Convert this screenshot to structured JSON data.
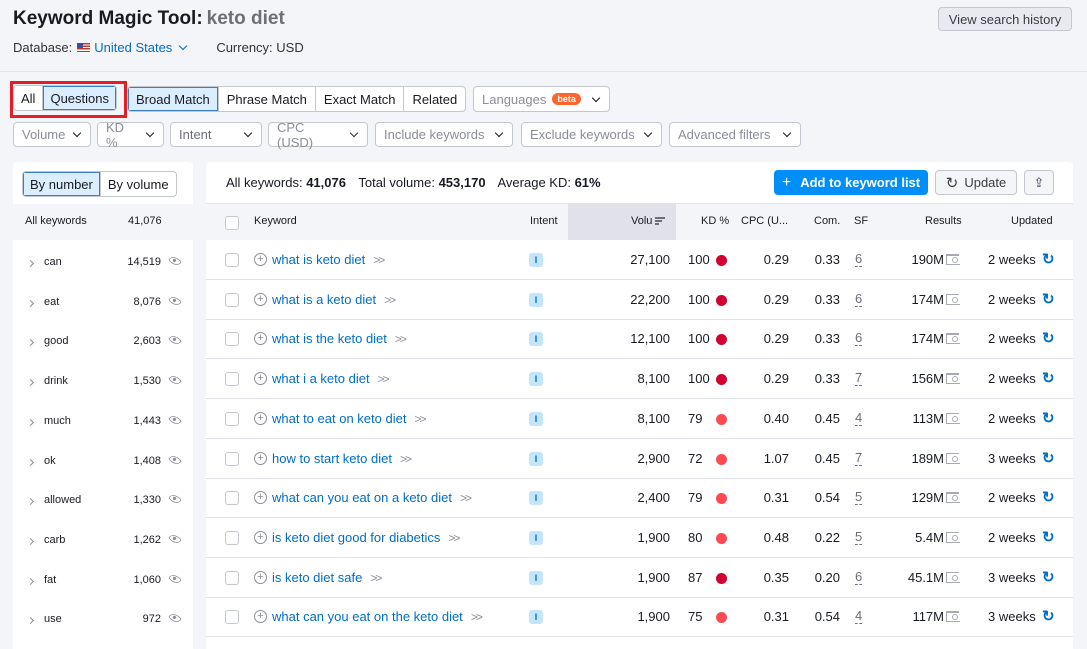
{
  "header": {
    "title": "Keyword Magic Tool:",
    "keyword": "keto diet",
    "database_label": "Database:",
    "database_value": "United States",
    "currency": "Currency: USD",
    "view_history": "View search history"
  },
  "mode_tabs": [
    {
      "label": "All",
      "active": false
    },
    {
      "label": "Questions",
      "active": true
    }
  ],
  "match_tabs": [
    {
      "label": "Broad Match",
      "active": true
    },
    {
      "label": "Phrase Match",
      "active": false
    },
    {
      "label": "Exact Match",
      "active": false
    },
    {
      "label": "Related",
      "active": false
    }
  ],
  "languages": {
    "label": "Languages",
    "badge": "beta"
  },
  "filters": [
    "Volume",
    "KD %",
    "Intent",
    "CPC (USD)",
    "Include keywords",
    "Exclude keywords",
    "Advanced filters"
  ],
  "sidebar": {
    "toggle": [
      {
        "label": "By number",
        "active": true
      },
      {
        "label": "By volume",
        "active": false
      }
    ],
    "all_label": "All keywords",
    "all_count": "41,076",
    "groups": [
      {
        "name": "can",
        "count": "14,519"
      },
      {
        "name": "eat",
        "count": "8,076"
      },
      {
        "name": "good",
        "count": "2,603"
      },
      {
        "name": "drink",
        "count": "1,530"
      },
      {
        "name": "much",
        "count": "1,443"
      },
      {
        "name": "ok",
        "count": "1,408"
      },
      {
        "name": "allowed",
        "count": "1,330"
      },
      {
        "name": "carb",
        "count": "1,262"
      },
      {
        "name": "fat",
        "count": "1,060"
      },
      {
        "name": "use",
        "count": "972"
      }
    ]
  },
  "summary": {
    "all_label": "All keywords:",
    "all_value": "41,076",
    "volume_label": "Total volume:",
    "volume_value": "453,170",
    "kd_label": "Average KD:",
    "kd_value": "61%"
  },
  "actions": {
    "add": "Add to keyword list",
    "update": "Update",
    "export_icon": "export-icon"
  },
  "columns": [
    "Keyword",
    "Intent",
    "Volu",
    "KD %",
    "CPC (U...",
    "Com.",
    "SF",
    "Results",
    "Updated"
  ],
  "colors": {
    "kd_hard": "#d1002f",
    "kd_difficult": "#ff4953",
    "accent": "#008ff8",
    "link": "#006dca"
  },
  "rows": [
    {
      "keyword": "what is keto diet",
      "intent": "I",
      "volume": "27,100",
      "kd": "100",
      "kd_level": "hard",
      "cpc": "0.29",
      "com": "0.33",
      "sf": "6",
      "results": "190M",
      "updated": "2 weeks"
    },
    {
      "keyword": "what is a keto diet",
      "intent": "I",
      "volume": "22,200",
      "kd": "100",
      "kd_level": "hard",
      "cpc": "0.29",
      "com": "0.33",
      "sf": "6",
      "results": "174M",
      "updated": "2 weeks"
    },
    {
      "keyword": "what is the keto diet",
      "intent": "I",
      "volume": "12,100",
      "kd": "100",
      "kd_level": "hard",
      "cpc": "0.29",
      "com": "0.33",
      "sf": "6",
      "results": "174M",
      "updated": "2 weeks"
    },
    {
      "keyword": "what i a keto diet",
      "intent": "I",
      "volume": "8,100",
      "kd": "100",
      "kd_level": "hard",
      "cpc": "0.29",
      "com": "0.33",
      "sf": "7",
      "results": "156M",
      "updated": "2 weeks"
    },
    {
      "keyword": "what to eat on keto diet",
      "intent": "I",
      "volume": "8,100",
      "kd": "79",
      "kd_level": "difficult",
      "cpc": "0.40",
      "com": "0.45",
      "sf": "4",
      "results": "113M",
      "updated": "2 weeks"
    },
    {
      "keyword": "how to start keto diet",
      "intent": "I",
      "volume": "2,900",
      "kd": "72",
      "kd_level": "difficult",
      "cpc": "1.07",
      "com": "0.45",
      "sf": "7",
      "results": "189M",
      "updated": "3 weeks"
    },
    {
      "keyword": "what can you eat on a keto diet",
      "intent": "I",
      "volume": "2,400",
      "kd": "79",
      "kd_level": "difficult",
      "cpc": "0.31",
      "com": "0.54",
      "sf": "5",
      "results": "129M",
      "updated": "2 weeks"
    },
    {
      "keyword": "is keto diet good for diabetics",
      "intent": "I",
      "volume": "1,900",
      "kd": "80",
      "kd_level": "difficult",
      "cpc": "0.48",
      "com": "0.22",
      "sf": "5",
      "results": "5.4M",
      "updated": "2 weeks"
    },
    {
      "keyword": "is keto diet safe",
      "intent": "I",
      "volume": "1,900",
      "kd": "87",
      "kd_level": "hard",
      "cpc": "0.35",
      "com": "0.20",
      "sf": "6",
      "results": "45.1M",
      "updated": "3 weeks"
    },
    {
      "keyword": "what can you eat on the keto diet",
      "intent": "I",
      "volume": "1,900",
      "kd": "75",
      "kd_level": "difficult",
      "cpc": "0.31",
      "com": "0.54",
      "sf": "4",
      "results": "117M",
      "updated": "3 weeks"
    }
  ]
}
